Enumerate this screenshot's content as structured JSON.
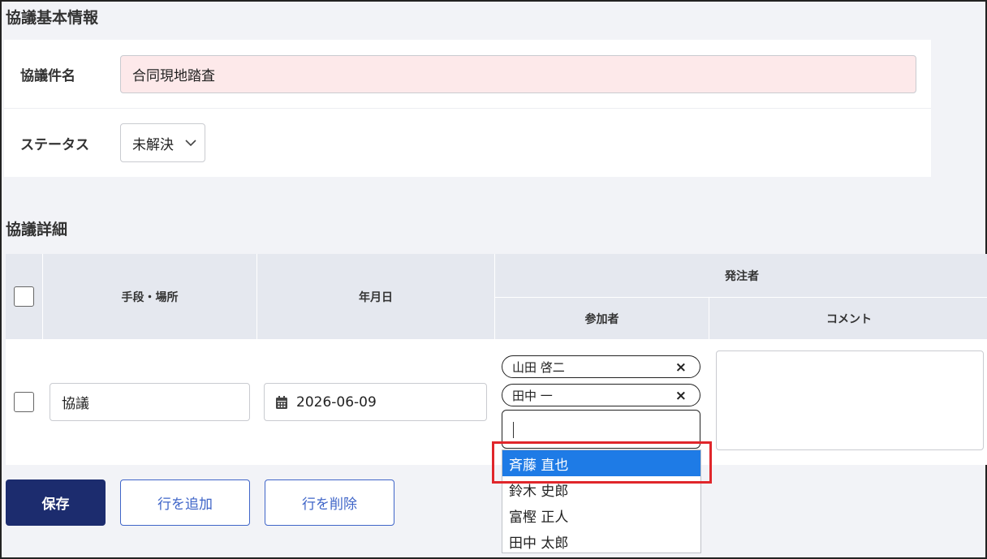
{
  "basic_info": {
    "section_title": "協議基本情報",
    "name_label": "協議件名",
    "name_value": "合同現地踏査",
    "status_label": "ステータス",
    "status_value": "未解決"
  },
  "detail": {
    "section_title": "協議詳細",
    "headers": {
      "method_place": "手段・場所",
      "date": "年月日",
      "orderer": "発注者",
      "participants": "参加者",
      "comment": "コメント"
    },
    "row": {
      "method_value": "協議",
      "date_value": "2026-06-09",
      "participant_chips": [
        "山田 啓二",
        "田中 一"
      ],
      "chip_remove": "×",
      "search_value": "",
      "comment_value": ""
    },
    "dropdown_options": [
      "斉藤 直也",
      "鈴木 史郎",
      "富樫 正人",
      "田中 太郎"
    ],
    "selected_option": "斉藤 直也"
  },
  "buttons": {
    "save": "保存",
    "add_row": "行を追加",
    "delete_row": "行を削除"
  },
  "colors": {
    "primary": "#1c2c6e",
    "accent": "#3f65c8",
    "selected": "#1e7be6",
    "highlight": "#e0262b",
    "required_bg": "#fde9ea"
  },
  "icons": {
    "status_dropdown": "chevron-down-icon",
    "date": "calendar-icon",
    "chip_remove": "close-icon"
  }
}
